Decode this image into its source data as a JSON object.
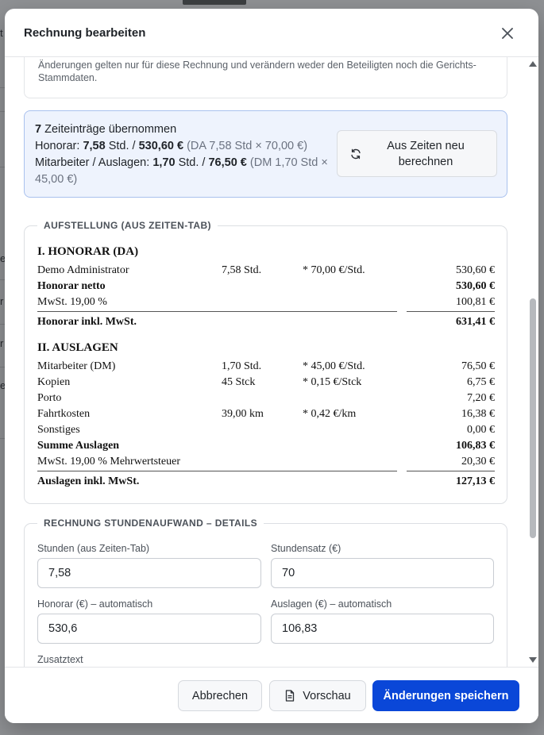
{
  "background": {
    "left_fragments": [
      "t",
      "e",
      "r",
      "r",
      "e"
    ]
  },
  "dialog": {
    "title": "Rechnung bearbeiten",
    "close_icon": "close-icon"
  },
  "info": {
    "text": "Änderungen gelten nur für diese Rechnung und verändern weder den Beteiligten noch die Gerichts-Stammdaten."
  },
  "summary": {
    "count": "7",
    "count_label": " Zeiteinträge übernommen",
    "honorar_label": "Honorar: ",
    "honorar_hours": "7,58",
    "honorar_hours_unit": " Std. / ",
    "honorar_amount": "530,60 €",
    "honorar_detail": " (DA 7,58 Std × 70,00 €)",
    "mitarbeiter_label": "Mitarbeiter / Auslagen: ",
    "mitarbeiter_hours": "1,70",
    "mitarbeiter_hours_unit": " Std. / ",
    "mitarbeiter_amount": "76,50 €",
    "mitarbeiter_detail": " (DM 1,70 Std × 45,00 €)",
    "recalc_button": "Aus Zeiten neu berechnen",
    "recalc_icon": "refresh-icon"
  },
  "aufstellung": {
    "legend": "AUFSTELLUNG (AUS ZEITEN-TAB)",
    "section1": "I. HONORAR (DA)",
    "row_admin": {
      "name": "Demo Administrator",
      "qty": "7,58 Std.",
      "rate": "* 70,00 €/Std.",
      "amount": "530,60 €"
    },
    "row_netto": {
      "name": "Honorar netto",
      "amount": "530,60 €"
    },
    "row_mwst1": {
      "name": "MwSt. 19,00 %",
      "amount": "100,81 €"
    },
    "row_inkl1": {
      "name": "Honorar inkl. MwSt.",
      "amount": "631,41 €"
    },
    "section2": "II. AUSLAGEN",
    "row_mitarb": {
      "name": "Mitarbeiter (DM)",
      "qty": "1,70 Std.",
      "rate": "* 45,00 €/Std.",
      "amount": "76,50 €"
    },
    "row_kopien": {
      "name": "Kopien",
      "qty": "45 Stck",
      "rate": "* 0,15 €/Stck",
      "amount": "6,75 €"
    },
    "row_porto": {
      "name": "Porto",
      "amount": "7,20 €"
    },
    "row_fahrt": {
      "name": "Fahrtkosten",
      "qty": "39,00 km",
      "rate": "* 0,42 €/km",
      "amount": "16,38 €"
    },
    "row_sonst": {
      "name": "Sonstiges",
      "amount": "0,00 €"
    },
    "row_summe": {
      "name": "Summe Auslagen",
      "amount": "106,83 €"
    },
    "row_mwst2": {
      "name": "MwSt. 19,00 % Mehrwertsteuer",
      "amount": "20,30 €"
    },
    "row_inkl2": {
      "name": "Auslagen inkl. MwSt.",
      "amount": "127,13 €"
    }
  },
  "details": {
    "legend": "RECHNUNG STUNDENAUFWAND – DETAILS",
    "stunden_label": "Stunden (aus Zeiten-Tab)",
    "stunden_value": "7,58",
    "satz_label": "Stundensatz (€)",
    "satz_value": "70",
    "honorar_label": "Honorar (€) – automatisch",
    "honorar_value": "530,6",
    "auslagen_label": "Auslagen (€) – automatisch",
    "auslagen_value": "106,83",
    "zusatz_label": "Zusatztext"
  },
  "footer": {
    "cancel": "Abbrechen",
    "preview": "Vorschau",
    "preview_icon": "document-icon",
    "save": "Änderungen speichern"
  }
}
